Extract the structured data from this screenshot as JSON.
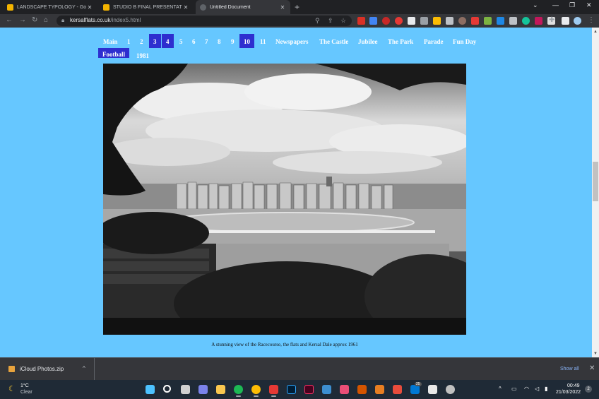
{
  "browser": {
    "tabs": [
      {
        "title": "LANDSCAPE TYPOLOGY - Google",
        "active": false,
        "icon": "google-slides-icon",
        "color": "#f4b400"
      },
      {
        "title": "STUDIO B FINAL PRESENTATION",
        "active": false,
        "icon": "google-slides-icon",
        "color": "#f4b400"
      },
      {
        "title": "Untitled Document",
        "active": true,
        "icon": "globe-icon",
        "color": "#9aa0a6"
      }
    ],
    "url_host": "kersalflats.co.uk",
    "url_path": "/index5.html"
  },
  "site": {
    "nav_row1": [
      {
        "label": "Main",
        "selected": false
      },
      {
        "label": "1",
        "selected": false
      },
      {
        "label": "2",
        "selected": false
      },
      {
        "label": "3",
        "selected": true
      },
      {
        "label": "4",
        "selected": true
      },
      {
        "label": "5",
        "selected": false
      },
      {
        "label": "6",
        "selected": false
      },
      {
        "label": "7",
        "selected": false
      },
      {
        "label": "8",
        "selected": false
      },
      {
        "label": "9",
        "selected": false
      },
      {
        "label": "10",
        "selected": true
      },
      {
        "label": "11",
        "selected": false
      },
      {
        "label": "Newspapers",
        "selected": false
      },
      {
        "label": "The Castle",
        "selected": false
      },
      {
        "label": "Jubilee",
        "selected": false
      },
      {
        "label": "The Park",
        "selected": false
      },
      {
        "label": "Parade",
        "selected": false
      },
      {
        "label": "Fun Day",
        "selected": false
      }
    ],
    "nav_row2": [
      {
        "label": "Football",
        "selected": true
      },
      {
        "label": "1981",
        "selected": false
      }
    ],
    "caption": "A stunning view of the Racecourse, the flats and Kersal Dale approx 1961",
    "accent_bg": "#66c7ff",
    "selected_bg": "#2e2ecf"
  },
  "downloads": {
    "file_name": "iCloud Photos.zip",
    "show_all": "Show all"
  },
  "taskbar": {
    "weather_temp": "1°C",
    "weather_cond": "Clear",
    "time": "00:49",
    "date": "21/03/2022",
    "notifications": "2",
    "messenger_badge": "25"
  }
}
